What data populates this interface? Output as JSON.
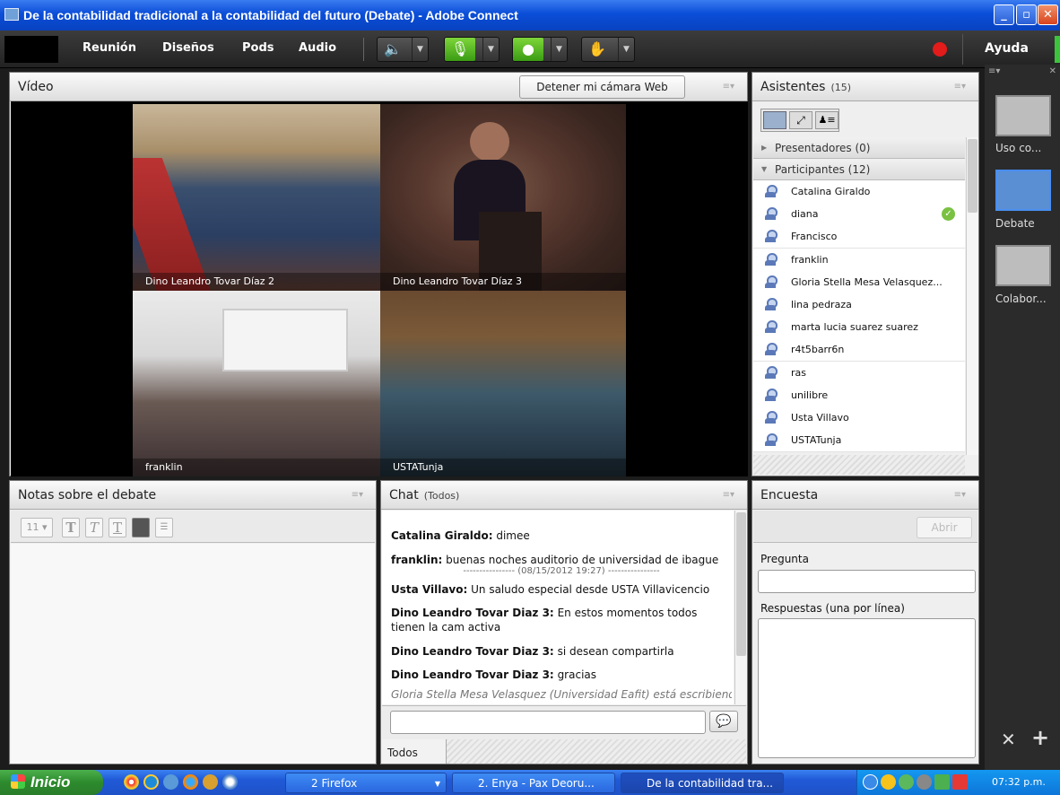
{
  "window": {
    "title": "De la contabilidad tradicional a la contabilidad del futuro (Debate) - Adobe Connect",
    "controls": [
      "_",
      "▫",
      "✕"
    ]
  },
  "menubar": {
    "items": [
      "Reunión",
      "Diseños",
      "Pods",
      "Audio"
    ],
    "help": "Ayuda"
  },
  "video_pod": {
    "title": "Vídeo",
    "stop_camera_label": "Detener mi cámara Web",
    "feeds": [
      {
        "name": "Dino Leandro Tovar Díaz 2"
      },
      {
        "name": "Dino Leandro Tovar Díaz 3"
      },
      {
        "name": "franklin"
      },
      {
        "name": "USTATunja"
      }
    ]
  },
  "attendees_pod": {
    "title": "Asistentes",
    "count": "(15)",
    "groups": [
      {
        "label": "Presentadores (0)",
        "expanded": false
      },
      {
        "label": "Participantes (12)",
        "expanded": true
      }
    ],
    "participants": [
      "Catalina Giraldo",
      "diana",
      "Francisco",
      "franklin",
      "Gloria Stella Mesa Velasquez...",
      "lina pedraza",
      "marta lucia suarez suarez",
      "r4t5barr6n",
      "ras",
      "unilibre",
      "Usta Villavo",
      "USTATunja"
    ]
  },
  "notes_pod": {
    "title": "Notas sobre el debate",
    "font_size": "11"
  },
  "chat_pod": {
    "title": "Chat",
    "scope": "(Todos)",
    "messages": [
      {
        "sender": "Catalina Giraldo:",
        "text": "dimee"
      },
      {
        "sender": "franklin:",
        "text": "buenas noches auditorio de universidad de ibague"
      },
      {
        "divider": "---------------- (08/15/2012 19:27) ----------------"
      },
      {
        "sender": "Usta Villavo:",
        "text": "Un saludo especial desde USTA Villavicencio"
      },
      {
        "sender": "Dino Leandro Tovar Diaz 3:",
        "text": "En estos momentos todos tienen la cam activa"
      },
      {
        "sender": "Dino Leandro Tovar Diaz 3:",
        "text": "si desean compartirla"
      },
      {
        "sender": "Dino Leandro Tovar Diaz 3:",
        "text": "gracias"
      }
    ],
    "typing": "Gloria Stella Mesa Velasquez (Universidad Eafit) está escribiendo...",
    "tab": "Todos"
  },
  "poll_pod": {
    "title": "Encuesta",
    "open_label": "Abrir",
    "question_label": "Pregunta",
    "answers_label": "Respuestas (una por línea)"
  },
  "layouts": [
    {
      "label": "Uso co...",
      "selected": false
    },
    {
      "label": "Debate",
      "selected": true
    },
    {
      "label": "Colabor...",
      "selected": false
    }
  ],
  "taskbar": {
    "start": "Inicio",
    "tasks": [
      "2 Firefox",
      "2. Enya - Pax Deoru...",
      "De la contabilidad tra..."
    ],
    "clock": "07:32 p.m."
  },
  "colors": {
    "accent_blue": "#2a5fd6",
    "rec_red": "#e21b1b",
    "mic_green": "#3a9b14"
  }
}
